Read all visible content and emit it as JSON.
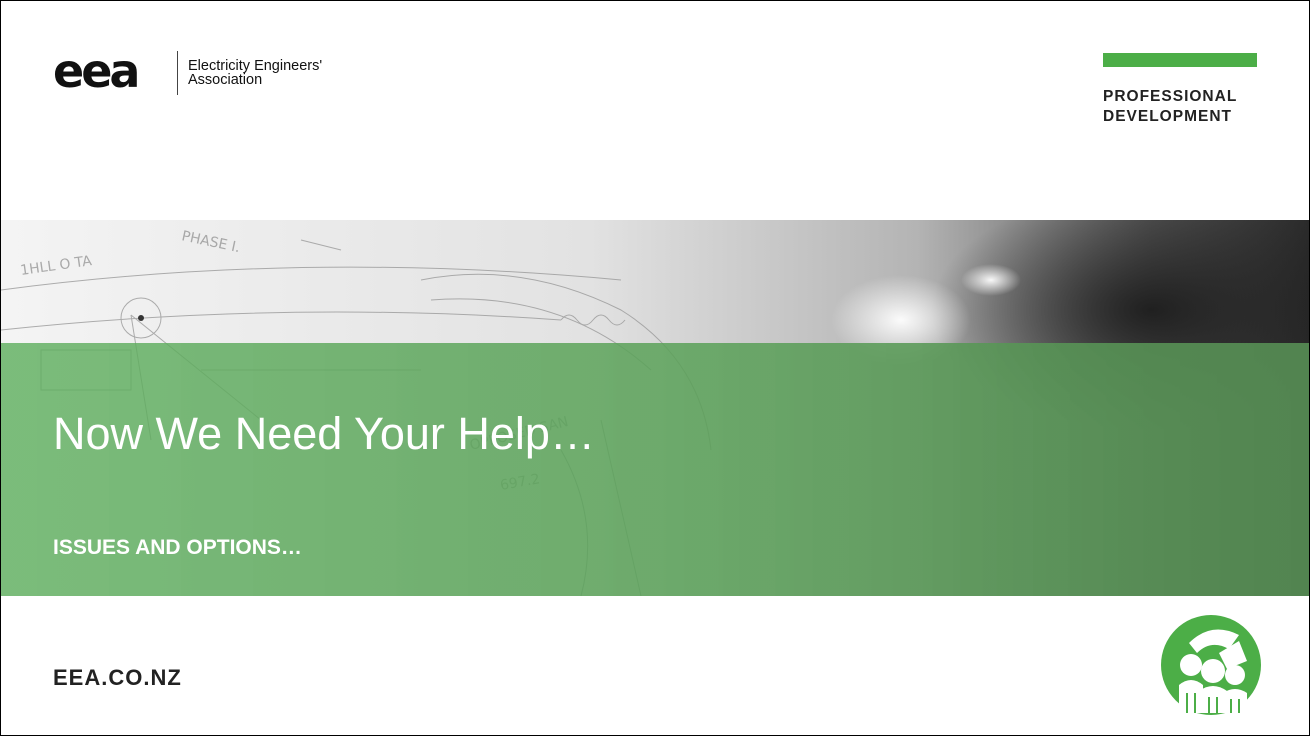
{
  "header": {
    "logo_word": "eea",
    "org_name_line1": "Electricity Engineers'",
    "org_name_line2": "Association",
    "program_line1": "PROFESSIONAL",
    "program_line2": "DEVELOPMENT"
  },
  "hero": {
    "title": "Now We Need Your Help…",
    "subtitle": "ISSUES AND OPTIONS…"
  },
  "footer": {
    "website": "EEA.CO.NZ"
  },
  "colors": {
    "brand_green": "#4cae47",
    "text_dark": "#222222",
    "white": "#ffffff"
  }
}
